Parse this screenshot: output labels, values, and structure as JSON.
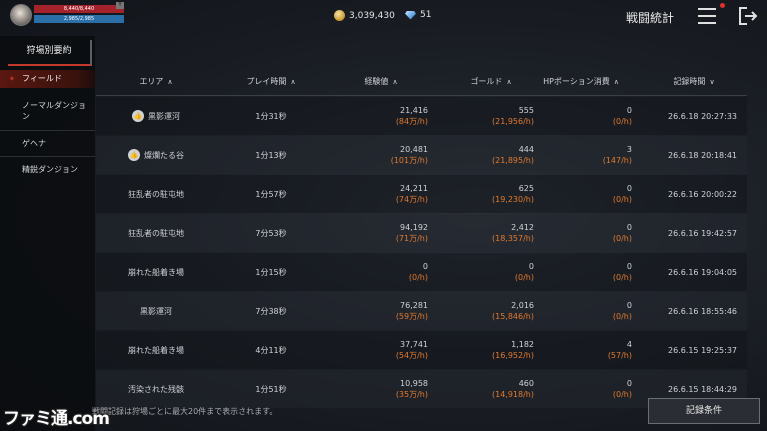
{
  "player": {
    "hp": "8,440/8,440",
    "mp": "2,985/2,985",
    "badge": "Y"
  },
  "currency": {
    "gold": "3,039,430",
    "gems": "51"
  },
  "header": {
    "title": "戦闘統計"
  },
  "sidebar": {
    "heading": "狩場別要約",
    "items": [
      {
        "label": "フィールド",
        "active": true
      },
      {
        "label": "ノーマルダンジョン"
      },
      {
        "label": "ゲヘナ"
      },
      {
        "label": "精鋭ダンジョン"
      }
    ]
  },
  "table": {
    "columns": [
      "エリア",
      "プレイ時間",
      "経験値",
      "ゴールド",
      "HPポーション消費",
      "記録時間"
    ],
    "sort_up": "∧",
    "sort_down": "∨",
    "rows": [
      {
        "area": "黒影運河",
        "liked": true,
        "time": "1分31秒",
        "exp": "21,416",
        "exp_rate": "(84万/h)",
        "gold": "555",
        "gold_rate": "(21,956/h)",
        "potion": "0",
        "potion_rate": "(0/h)",
        "recorded": "26.6.18 20:27:33"
      },
      {
        "area": "燦爛たる谷",
        "liked": true,
        "time": "1分13秒",
        "exp": "20,481",
        "exp_rate": "(101万/h)",
        "gold": "444",
        "gold_rate": "(21,895/h)",
        "potion": "3",
        "potion_rate": "(147/h)",
        "recorded": "26.6.18 20:18:41"
      },
      {
        "area": "狂乱者の駐屯地",
        "time": "1分57秒",
        "exp": "24,211",
        "exp_rate": "(74万/h)",
        "gold": "625",
        "gold_rate": "(19,230/h)",
        "potion": "0",
        "potion_rate": "(0/h)",
        "recorded": "26.6.16 20:00:22"
      },
      {
        "area": "狂乱者の駐屯地",
        "time": "7分53秒",
        "exp": "94,192",
        "exp_rate": "(71万/h)",
        "gold": "2,412",
        "gold_rate": "(18,357/h)",
        "potion": "0",
        "potion_rate": "(0/h)",
        "recorded": "26.6.16 19:42:57"
      },
      {
        "area": "崩れた船着き場",
        "time": "1分15秒",
        "exp": "0",
        "exp_rate": "(0/h)",
        "gold": "0",
        "gold_rate": "(0/h)",
        "potion": "0",
        "potion_rate": "(0/h)",
        "recorded": "26.6.16 19:04:05"
      },
      {
        "area": "黒影運河",
        "time": "7分38秒",
        "exp": "76,281",
        "exp_rate": "(59万/h)",
        "gold": "2,016",
        "gold_rate": "(15,846/h)",
        "potion": "0",
        "potion_rate": "(0/h)",
        "recorded": "26.6.16 18:55:46"
      },
      {
        "area": "崩れた船着き場",
        "time": "4分11秒",
        "exp": "37,741",
        "exp_rate": "(54万/h)",
        "gold": "1,182",
        "gold_rate": "(16,952/h)",
        "potion": "4",
        "potion_rate": "(57/h)",
        "recorded": "26.6.15 19:25:37"
      },
      {
        "area": "汚染された残骸",
        "time": "1分51秒",
        "exp": "10,958",
        "exp_rate": "(35万/h)",
        "gold": "460",
        "gold_rate": "(14,918/h)",
        "potion": "0",
        "potion_rate": "(0/h)",
        "recorded": "26.6.15 18:44:29"
      }
    ]
  },
  "footer": {
    "note": "戦闘記録は狩場ごとに最大20件まで表示されます。",
    "button": "記録条件",
    "watermark": "ファミ通.com"
  },
  "colors": {
    "accent_red": "#c33a2a",
    "rate_orange": "#e07a2e"
  }
}
